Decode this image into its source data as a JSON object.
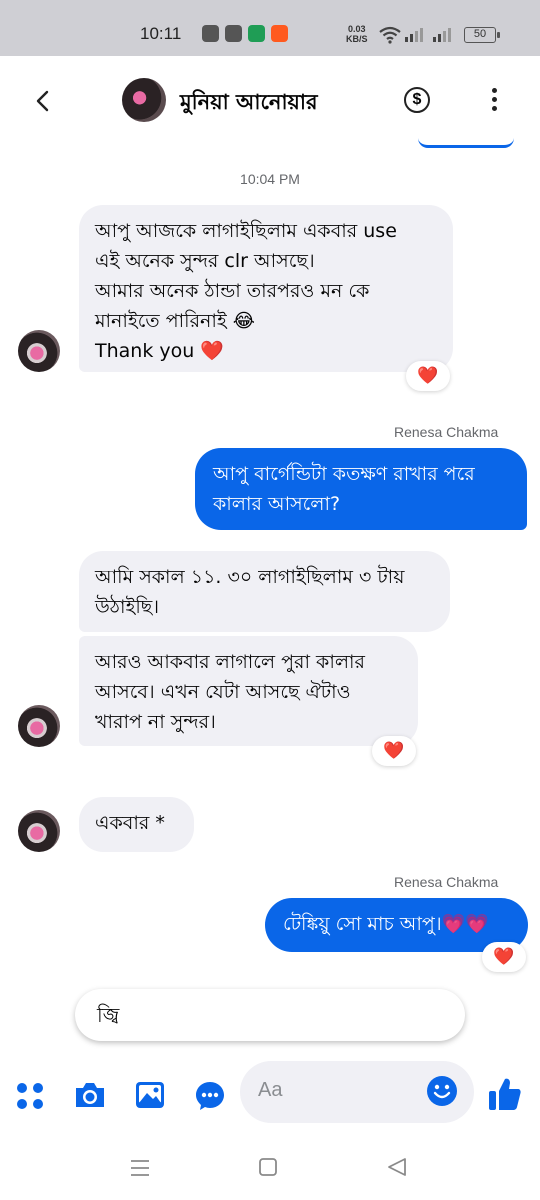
{
  "status_bar": {
    "time": "10:11",
    "net_speed_value": "0.03",
    "net_speed_unit": "KB/S",
    "battery": "50"
  },
  "header": {
    "contact_name": "মুনিয়া আনোয়ার",
    "back_icon": "chevron-left-icon",
    "payment_icon": "dollar-icon",
    "more_icon": "more-vertical-icon"
  },
  "conversation": {
    "timestamp": "10:04 PM",
    "messages": [
      {
        "direction": "incoming",
        "text": "আপু আজকে লাগাইছিলাম একবার use\nএই অনেক সুন্দর clr আসছে।\nআমার অনেক ঠান্ডা তারপরও মন কে\nমানাইতে পারিনাই 😂\nThank you ❤️",
        "reaction": "❤️"
      },
      {
        "direction": "outgoing",
        "sender": "Renesa Chakma",
        "text": "আপু বার্গেন্ডিটা কতক্ষণ রাখার পরে\nকালার আসলো?"
      },
      {
        "direction": "incoming",
        "text": "আমি সকাল ১১. ৩০ লাগাইছিলাম ৩ টায়\nউঠাইছি।"
      },
      {
        "direction": "incoming",
        "text": "আরও আকবার লাগালে পুরা কালার\nআসবে। এখন যেটা আসছে ঐটাও\nখারাপ না সুন্দর।",
        "reaction": "❤️"
      },
      {
        "direction": "incoming",
        "text": "একবার *"
      },
      {
        "direction": "outgoing",
        "sender": "Renesa Chakma",
        "text": "টেঙ্কিয়ু সো মাচ আপু।💗💗",
        "reaction": "❤️"
      }
    ]
  },
  "suggestion": {
    "text": "জ্বি"
  },
  "composer": {
    "placeholder": "Aa",
    "icons": [
      "apps-icon",
      "camera-icon",
      "gallery-icon",
      "chat-extension-icon",
      "emoji-icon",
      "thumbs-up-icon"
    ]
  },
  "nav_bar": {
    "icons": [
      "recents-icon",
      "home-icon",
      "back-icon"
    ]
  },
  "colors": {
    "accent": "#0a66e8",
    "incoming_bubble": "#f0f0f5",
    "reaction_heart": "#e41e3f"
  }
}
